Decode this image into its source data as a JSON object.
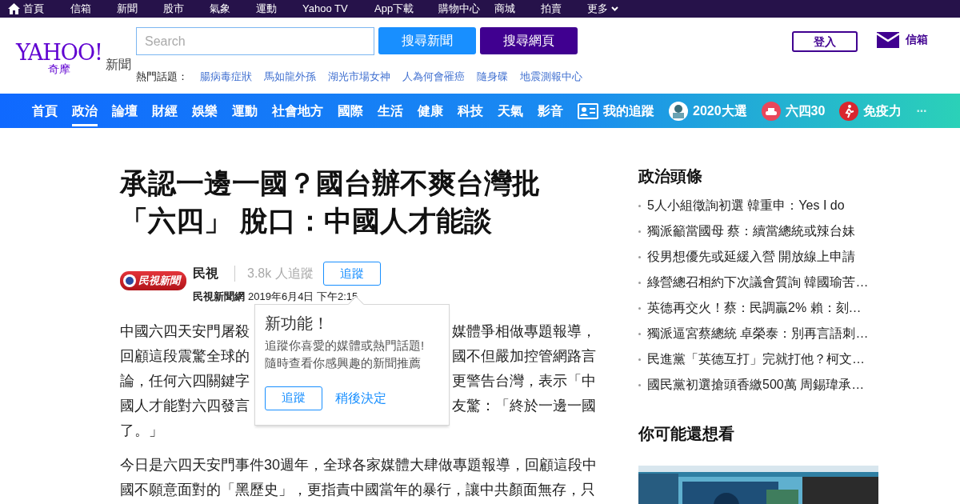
{
  "top_bar": {
    "items": [
      {
        "label": "首頁",
        "kind": "home"
      },
      {
        "label": "信箱",
        "kind": "plain"
      },
      {
        "label": "新聞",
        "kind": "plain"
      },
      {
        "label": "股市",
        "kind": "plain"
      },
      {
        "label": "氣象",
        "kind": "plain"
      },
      {
        "label": "運動",
        "kind": "plain"
      },
      {
        "label": "Yahoo TV",
        "kind": "plain"
      },
      {
        "label": "App下載",
        "kind": "plain"
      },
      {
        "label": "購物中心",
        "kind": "plain"
      },
      {
        "label": "商城",
        "kind": "plain"
      },
      {
        "label": "拍賣",
        "kind": "plain"
      },
      {
        "label": "更多",
        "kind": "more"
      }
    ]
  },
  "header": {
    "logo": {
      "brand": "YAHOO!",
      "sub": "奇摩",
      "section": "新聞"
    },
    "search": {
      "placeholder": "Search"
    },
    "buttons": [
      {
        "label": "搜尋新聞",
        "kind": "news"
      },
      {
        "label": "搜尋網頁",
        "kind": "web"
      }
    ],
    "hot_label": "熱門話題：",
    "hot_topics": [
      "腸病毒症狀",
      "馬如龍外孫",
      "湖光市場女神",
      "人為何會罹癌",
      "隨身碟",
      "地震測報中心"
    ],
    "login": "登入",
    "mail": "信箱"
  },
  "nav": {
    "items": [
      {
        "label": "首頁",
        "kind": "plain",
        "selected": false
      },
      {
        "label": "政治",
        "kind": "plain",
        "selected": true
      },
      {
        "label": "論壇",
        "kind": "plain",
        "selected": false
      },
      {
        "label": "財經",
        "kind": "plain",
        "selected": false
      },
      {
        "label": "娛樂",
        "kind": "plain",
        "selected": false
      },
      {
        "label": "運動",
        "kind": "plain",
        "selected": false
      },
      {
        "label": "社會地方",
        "kind": "plain",
        "selected": false
      },
      {
        "label": "國際",
        "kind": "plain",
        "selected": false
      },
      {
        "label": "生活",
        "kind": "plain",
        "selected": false
      },
      {
        "label": "健康",
        "kind": "plain",
        "selected": false
      },
      {
        "label": "科技",
        "kind": "plain",
        "selected": false
      },
      {
        "label": "天氣",
        "kind": "plain",
        "selected": false
      },
      {
        "label": "影音",
        "kind": "plain",
        "selected": false
      },
      {
        "label": "我的追蹤",
        "kind": "follow",
        "selected": false
      },
      {
        "label": "2020大選",
        "kind": "vote",
        "selected": false
      },
      {
        "label": "六四30",
        "kind": "tank",
        "selected": false
      },
      {
        "label": "免疫力",
        "kind": "health",
        "selected": false
      },
      {
        "label": "···",
        "kind": "more",
        "selected": false
      }
    ]
  },
  "article": {
    "title_lines": [
      "承認一邊一國？國台辦不爽台灣批",
      "「六四」 脫口：中國人才能談"
    ],
    "source": {
      "logo_text": "民視新聞",
      "name": "民視",
      "followers": "3.8k 人追蹤",
      "follow_button": "追蹤",
      "publisher": "民視新聞網",
      "time": "2019年6月4日 下午2:15"
    },
    "paragraph_1_lines": [
      {
        "left": "中國六四天安門屠殺",
        "right": "媒體爭相做專題報導，"
      },
      {
        "left": "回顧這段震驚全球的",
        "right": "國不但嚴加控管網路言"
      },
      {
        "left": "論，任何六四關鍵字",
        "right": "更警告台灣，表示「中"
      },
      {
        "left": "國人才能對六四發言",
        "right": "友驚：「終於一邊一國"
      },
      {
        "left": "了。」"
      }
    ],
    "paragraph_2_lines": [
      "今日是六四天安門事件30週年，全球各家媒體大肆做專題報導，回顧這段中",
      "國不願意面對的「黑歷史」，更指責中國當年的暴行，讓中共顏面無存，只"
    ]
  },
  "popover": {
    "title": "新功能！",
    "lines": [
      "追蹤你喜愛的媒體或熱門話題!",
      "隨時查看你感興趣的新聞推薦"
    ],
    "follow_button": "追蹤",
    "later_link": "稍後決定"
  },
  "sidebar": {
    "headlines_title": "政治頭條",
    "headlines": [
      "5人小組徵詢初選 韓重申：Yes I do",
      "獨派籲當國母 蔡：續當總統或辣台妹",
      "役男想優先或延緩入營 開放線上申請",
      "綠營總召相約下次議會質詢 韓國瑜苦…",
      "英德再交火！蔡：民調贏2% 賴：刻…",
      "獨派逼宮蔡總統 卓榮泰：別再言語刺…",
      "民進黨「英德互打」完就打他？柯文…",
      "國民黨初選搶頭香繳500萬 周錫瑋承…"
    ],
    "more_title": "你可能還想看"
  }
}
